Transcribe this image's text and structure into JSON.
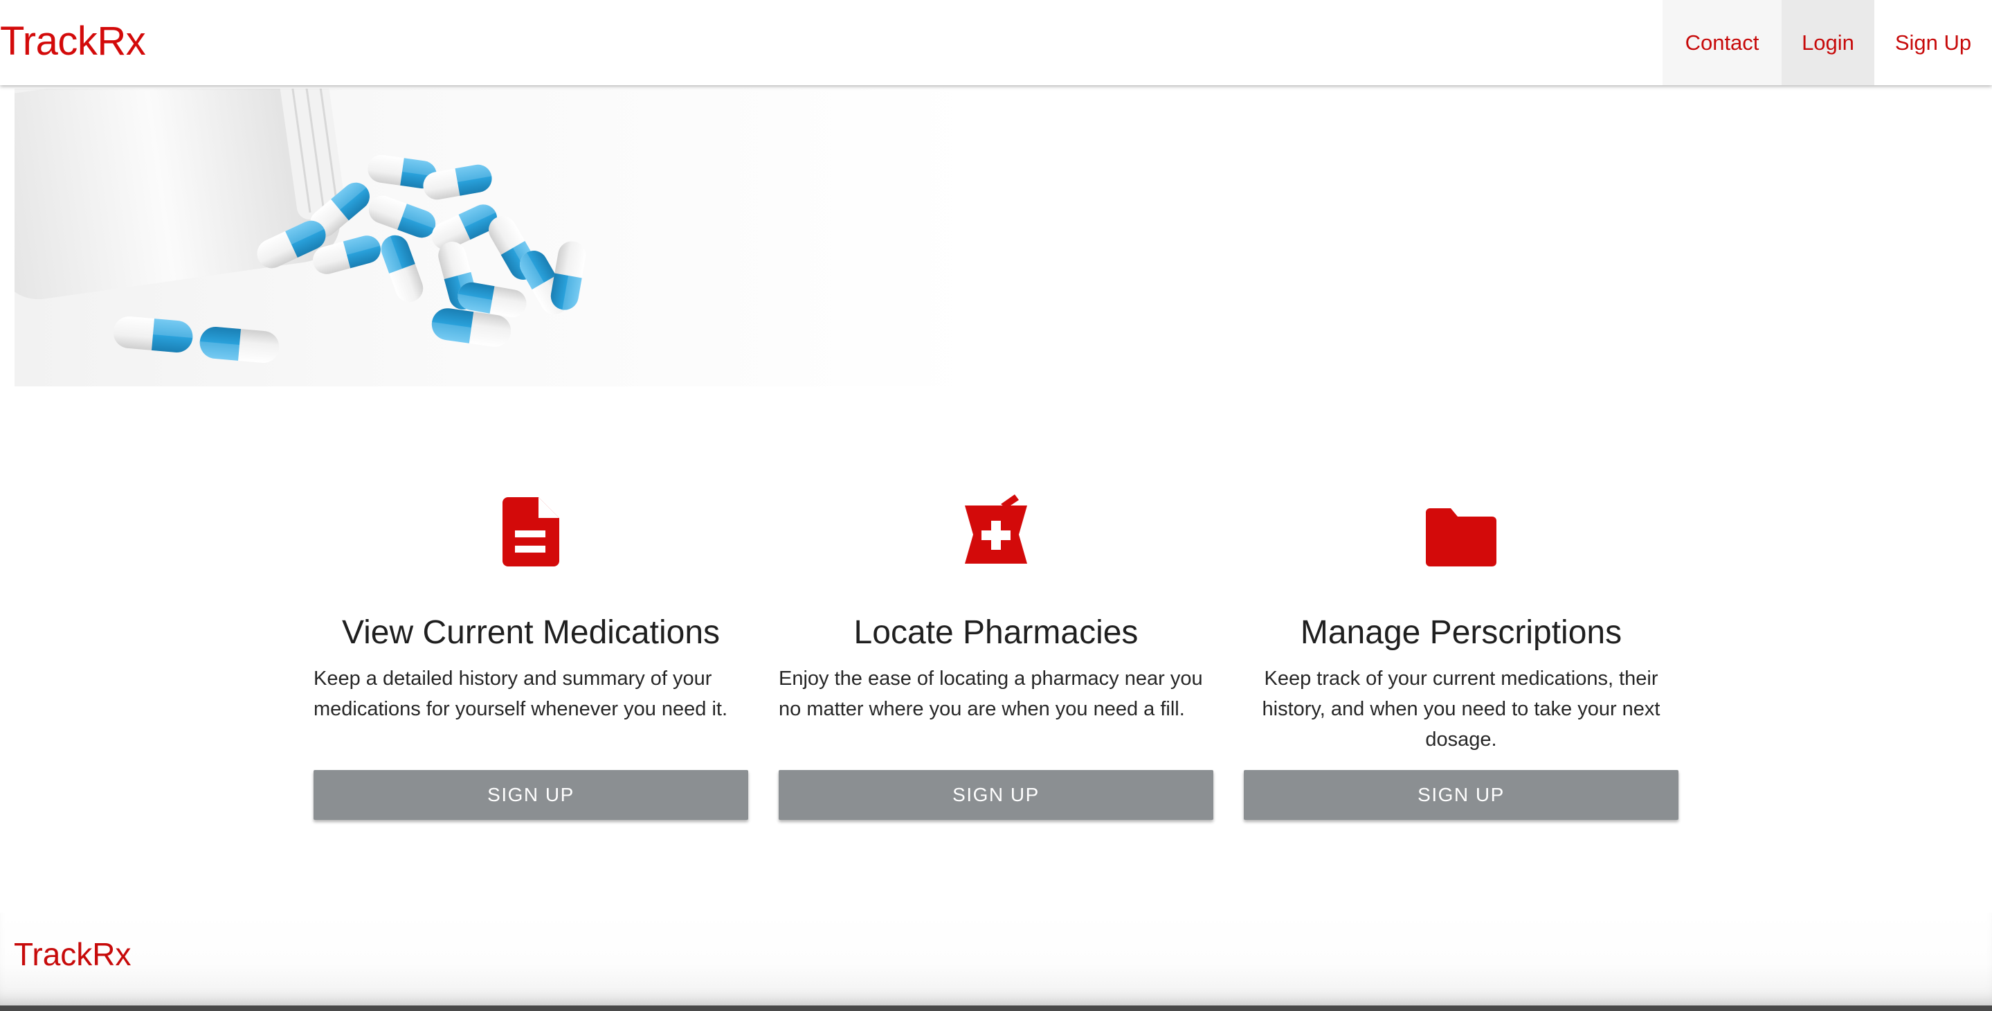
{
  "navbar": {
    "brand": "TrackRx",
    "items": [
      {
        "label": "Contact"
      },
      {
        "label": "Login"
      },
      {
        "label": "Sign Up"
      }
    ]
  },
  "hero": {
    "image_icon": "pills-image"
  },
  "features": [
    {
      "icon": "document-icon",
      "title": "View Current Medications",
      "description": "Keep a detailed history and summary of your medications for yourself whenever you need it.",
      "button": "SIGN UP"
    },
    {
      "icon": "pharmacy-icon",
      "title": "Locate Pharmacies",
      "description": "Enjoy the ease of locating a pharmacy near you no matter where you are when you need a fill.",
      "button": "SIGN UP"
    },
    {
      "icon": "folder-icon",
      "title": "Manage Perscriptions",
      "description": "Keep track of your current medications, their history, and when you need to take your next dosage.",
      "button": "SIGN UP"
    }
  ],
  "footer": {
    "brand": "TrackRx"
  },
  "colors": {
    "brand_red": "#d30a0a",
    "button_gray": "#8b8f92",
    "capsule_blue": "#2aa2dc"
  }
}
